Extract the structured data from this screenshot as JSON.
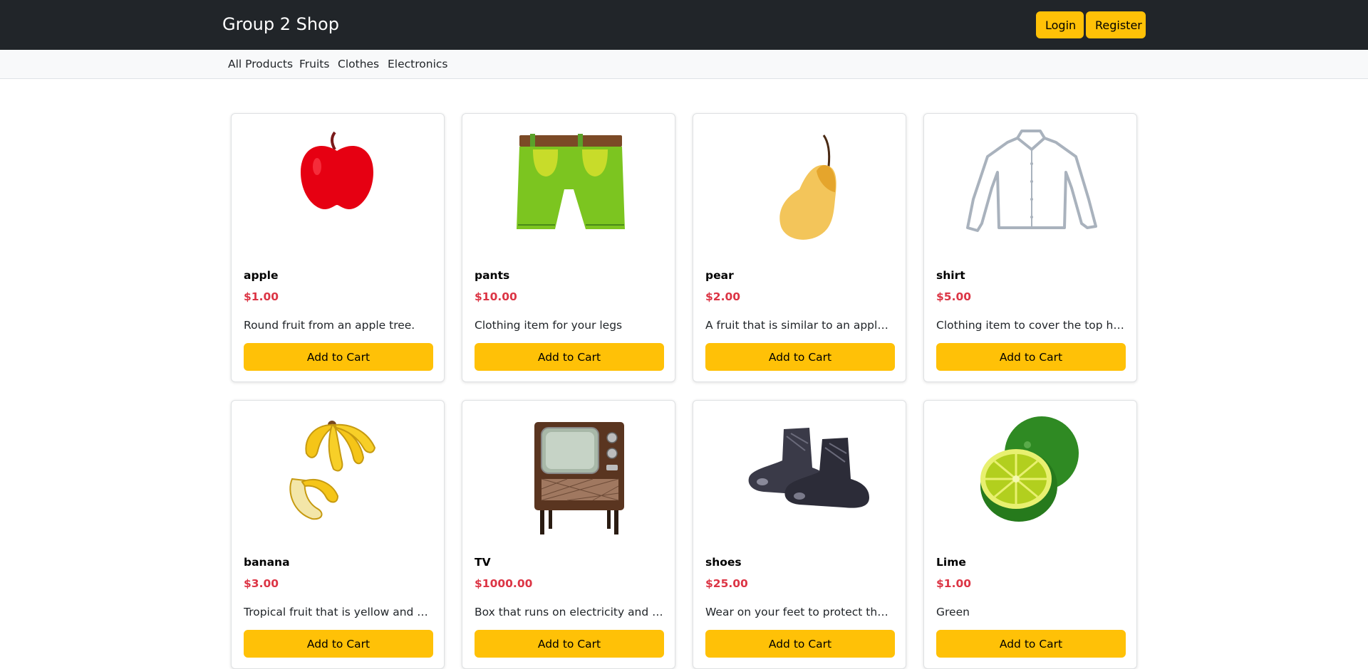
{
  "header": {
    "brand": "Group 2 Shop",
    "login_label": "Login",
    "register_label": "Register",
    "accent_color": "#ffc107",
    "bar_color": "#212529"
  },
  "nav": {
    "items": [
      "All Products",
      "Fruits",
      "Clothes",
      "Electronics"
    ]
  },
  "products": [
    {
      "name": "apple",
      "price": "$1.00",
      "description": "Round fruit from an apple tree.",
      "button": "Add to Cart",
      "icon": "apple-image"
    },
    {
      "name": "pants",
      "price": "$10.00",
      "description": "Clothing item for your legs",
      "button": "Add to Cart",
      "icon": "pants-image"
    },
    {
      "name": "pear",
      "price": "$2.00",
      "description": "A fruit that is similar to an apple but...",
      "button": "Add to Cart",
      "icon": "pear-image"
    },
    {
      "name": "shirt",
      "price": "$5.00",
      "description": "Clothing item to cover the top half ...",
      "button": "Add to Cart",
      "icon": "shirt-image"
    },
    {
      "name": "banana",
      "price": "$3.00",
      "description": "Tropical fruit that is yellow and gro...",
      "button": "Add to Cart",
      "icon": "banana-image"
    },
    {
      "name": "TV",
      "price": "$1000.00",
      "description": "Box that runs on electricity and play...",
      "button": "Add to Cart",
      "icon": "tv-image"
    },
    {
      "name": "shoes",
      "price": "$25.00",
      "description": "Wear on your feet to protect them f...",
      "button": "Add to Cart",
      "icon": "shoes-image"
    },
    {
      "name": "Lime",
      "price": "$1.00",
      "description": "Green",
      "button": "Add to Cart",
      "icon": "lime-image"
    }
  ]
}
